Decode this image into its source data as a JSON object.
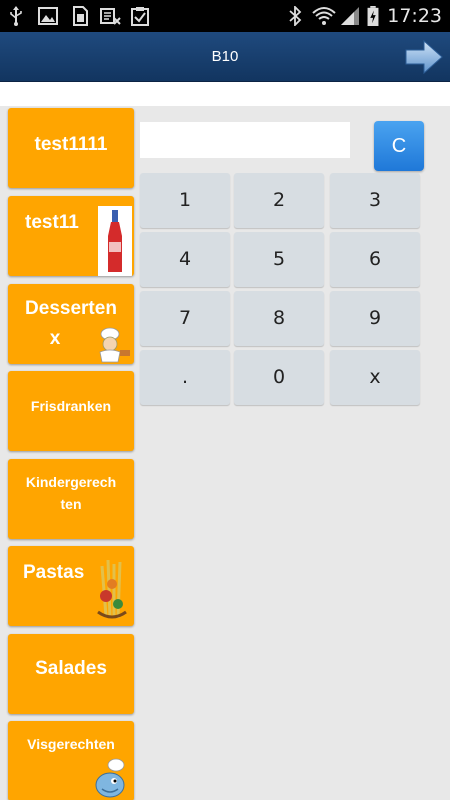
{
  "status_bar": {
    "time": "17:23",
    "icons_left": [
      "usb-icon",
      "image-icon",
      "sim-icon",
      "blocked-icon",
      "clipboard-check-icon"
    ],
    "icons_right": [
      "bluetooth-icon",
      "wifi-icon",
      "signal-icon",
      "battery-charging-icon"
    ]
  },
  "header": {
    "title": "B10",
    "next_icon": "arrow-right-icon"
  },
  "categories": [
    {
      "label_lines": [
        "test1111"
      ],
      "picture": null
    },
    {
      "label_lines": [
        "test11"
      ],
      "picture": "bottle-picture"
    },
    {
      "label_lines": [
        "Desserten",
        "x"
      ],
      "picture": "chef-picture"
    },
    {
      "label_lines": [
        "Frisdranken"
      ],
      "picture": null
    },
    {
      "label_lines": [
        "Kindergerech",
        "ten"
      ],
      "picture": null
    },
    {
      "label_lines": [
        "Pastas"
      ],
      "picture": "pasta-picture"
    },
    {
      "label_lines": [
        "Salades"
      ],
      "picture": null
    },
    {
      "label_lines": [
        "Visgerechten"
      ],
      "picture": "fish-chef-picture"
    }
  ],
  "keypad": {
    "display_value": "",
    "clear_label": "C",
    "keys": [
      "1",
      "2",
      "3",
      "4",
      "5",
      "6",
      "7",
      "8",
      "9",
      ".",
      "0",
      "x"
    ]
  },
  "colors": {
    "category_bg": "#ffa500",
    "header_bg": "#1f4a7e",
    "key_bg": "#d7dde2",
    "clear_bg": "#1f78d8"
  }
}
